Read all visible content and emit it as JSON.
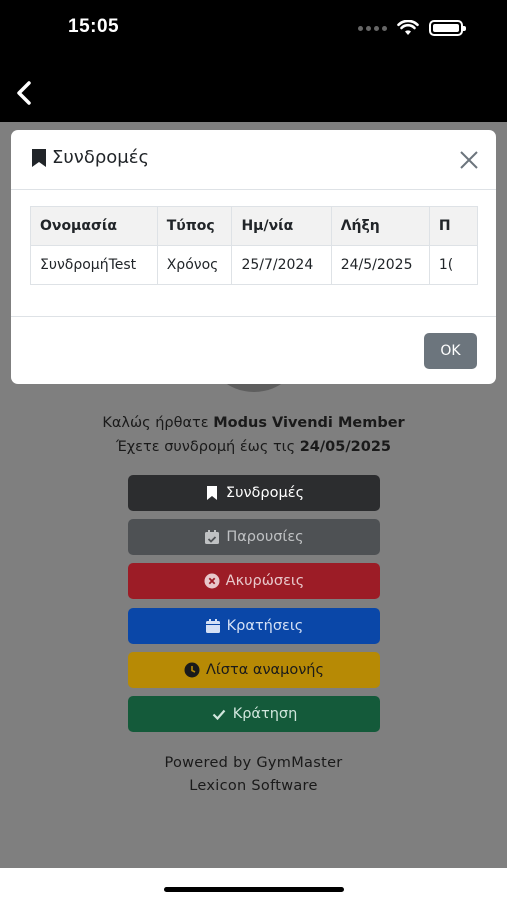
{
  "status_bar": {
    "time": "15:05"
  },
  "page": {
    "welcome_prefix": "Καλώς ήρθατε ",
    "member_name": "Modus Vivendi Member",
    "subscription_prefix": "Έχετε συνδρομή έως τις ",
    "subscription_until": "24/05/2025",
    "buttons": {
      "subscriptions": "Συνδρομές",
      "attendance": "Παρουσίες",
      "cancellations": "Ακυρώσεις",
      "bookings": "Κρατήσεις",
      "waitlist": "Λίστα αναμονής",
      "reserve": "Κράτηση"
    },
    "powered_by": "Powered by GymMaster",
    "company": "Lexicon Software"
  },
  "modal": {
    "title": "Συνδρομές",
    "ok_label": "OK",
    "table": {
      "headers": [
        "Ονομασία",
        "Τύπος",
        "Ημ/νία",
        "Λήξη",
        "Π"
      ],
      "rows": [
        [
          "ΣυνδρομήTest",
          "Χρόνος",
          "25/7/2024",
          "24/5/2025",
          "1("
        ]
      ]
    }
  },
  "colors": {
    "subscriptions": "#2c2d2f",
    "attendance": "#4e5154",
    "cancellations": "#9c1c26",
    "bookings": "#0a47a8",
    "waitlist": "#b78a05",
    "reserve": "#145a3a",
    "ok_button": "#6c757d"
  }
}
